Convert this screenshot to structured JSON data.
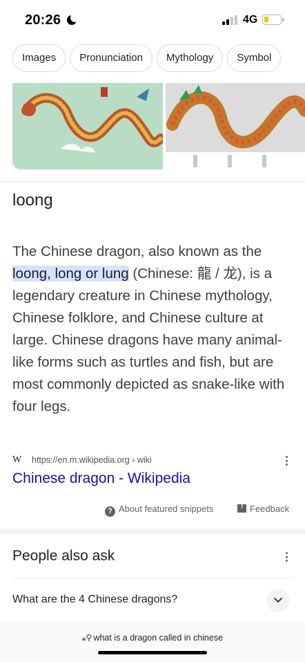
{
  "status_bar": {
    "time": "20:26",
    "network": "4G",
    "icons": [
      "moon-icon",
      "signal-icon",
      "battery-icon"
    ],
    "battery_level": 0.2,
    "battery_color": "#f4c400"
  },
  "chips": [
    "Images",
    "Pronunciation",
    "Mythology",
    "Symbol"
  ],
  "snippet": {
    "heading": "loong",
    "text_before": "The Chinese dragon, also known as the ",
    "highlight": "loong, long or lung",
    "text_after": " (Chinese: 龍 / 龙), is a legendary creature in Chinese mythology, Chinese folklore, and Chinese culture at large. Chinese dragons have many animal-like forms such as turtles and fish, but are most commonly depicted as snake-like with four legs.",
    "highlight_color": "#d3e3fd"
  },
  "source": {
    "icon": "W",
    "url": "https://en.m.wikipedia.org › wiki",
    "title": "Chinese dragon - Wikipedia",
    "link_color": "#1a0dab"
  },
  "meta": {
    "about": "About featured snippets",
    "feedback": "Feedback"
  },
  "people_also_ask": {
    "title": "People also ask",
    "questions": [
      "What are the 4 Chinese dragons?"
    ]
  },
  "url_bar": {
    "text": "what is a dragon called in chinese"
  }
}
